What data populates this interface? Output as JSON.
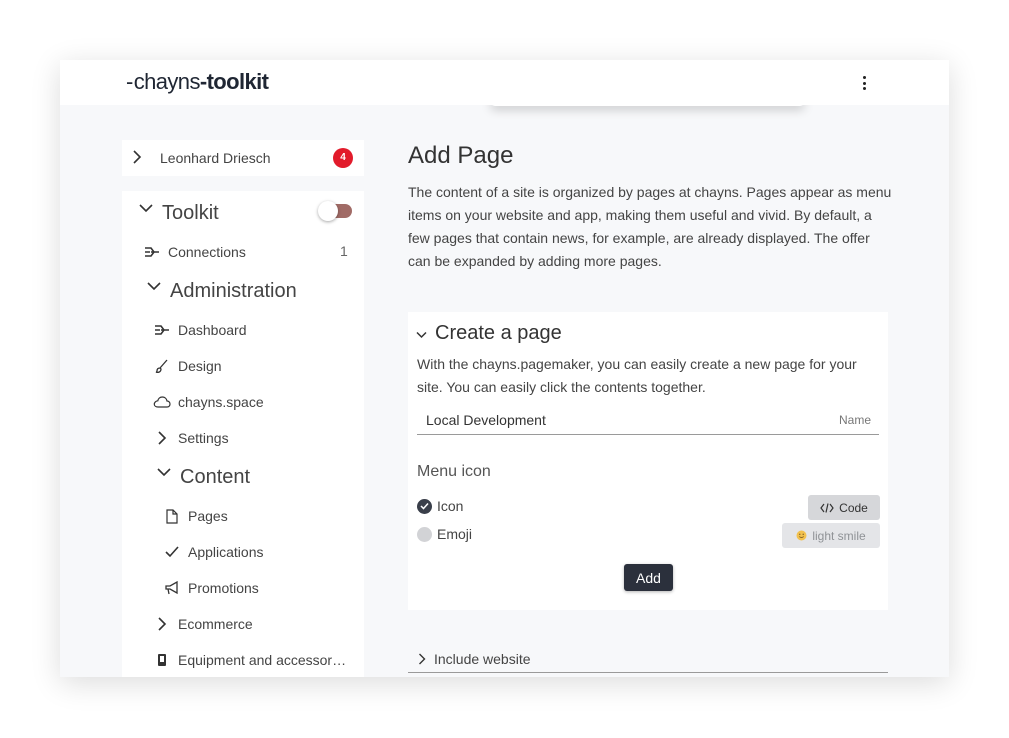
{
  "header": {
    "logo_prefix": "chayns",
    "logo_suffix": "-toolkit"
  },
  "sidebar": {
    "user": {
      "name": "Leonhard Driesch",
      "badge": "4"
    },
    "toolkit": {
      "label": "Toolkit",
      "toggle_on": false
    },
    "items": [
      {
        "label": "Connections",
        "count": "1"
      },
      {
        "label": "Administration"
      },
      {
        "label": "Dashboard"
      },
      {
        "label": "Design"
      },
      {
        "label": "chayns.space"
      },
      {
        "label": "Settings"
      },
      {
        "label": "Content"
      },
      {
        "label": "Pages"
      },
      {
        "label": "Applications"
      },
      {
        "label": "Promotions"
      },
      {
        "label": "Ecommerce"
      },
      {
        "label": "Equipment and accessor…"
      }
    ]
  },
  "main": {
    "title": "Add Page",
    "intro": "The content of a site is organized by pages at chayns. Pages appear as menu items on your website and app, making them useful and vivid. By default, a few pages that contain news, for example, are already displayed. The offer can be expanded by adding more pages.",
    "create": {
      "title": "Create a page",
      "description": "With the chayns.pagemaker, you can easily create a new page for your site. You can easily click the contents together.",
      "name_value": "Local Development",
      "name_label": "Name",
      "menu_icon_label": "Menu icon",
      "option_icon": "Icon",
      "option_emoji": "Emoji",
      "code_button": "Code",
      "emoji_button": "light smile",
      "add_button": "Add"
    },
    "include_website": "Include website"
  },
  "colors": {
    "badge": "#e21b2b",
    "toggle": "#a16b66",
    "primary_button": "#2b303c",
    "background": "#f7f8fa"
  }
}
